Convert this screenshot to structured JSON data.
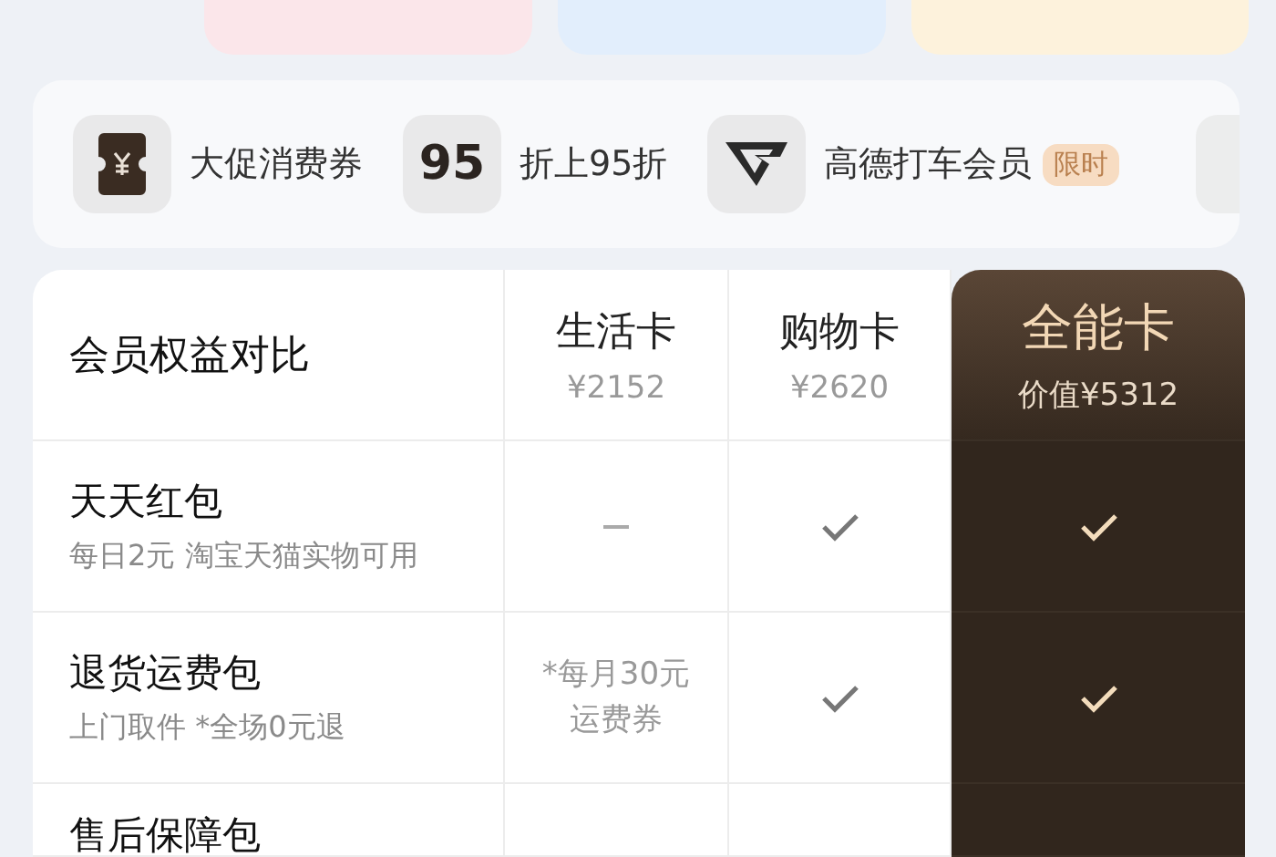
{
  "top_cards": [
    {
      "color": "#fbe6ea"
    },
    {
      "color": "#e2eefc"
    },
    {
      "color": "#fdf2dc"
    }
  ],
  "perks": [
    {
      "kind": "ticket",
      "label": "大促消费券"
    },
    {
      "kind": "number",
      "icon_text": "95",
      "label": "折上95折"
    },
    {
      "kind": "logo",
      "label": "高德打车会员",
      "badge": "限时"
    }
  ],
  "table": {
    "title": "会员权益对比",
    "plans": [
      {
        "name": "生活卡",
        "price": "¥2152",
        "featured": false
      },
      {
        "name": "购物卡",
        "price": "¥2620",
        "featured": false
      },
      {
        "name": "全能卡",
        "price": "价值¥5312",
        "featured": true
      }
    ],
    "rows": [
      {
        "name": "天天红包",
        "desc": "每日2元 淘宝天猫实物可用",
        "cells": [
          {
            "kind": "dash"
          },
          {
            "kind": "check"
          },
          {
            "kind": "check"
          }
        ]
      },
      {
        "name": "退货运费包",
        "desc": "上门取件 *全场0元退",
        "cells": [
          {
            "kind": "text",
            "lines": [
              "*每月30元",
              "运费券"
            ]
          },
          {
            "kind": "check"
          },
          {
            "kind": "check"
          }
        ]
      },
      {
        "name": "售后保障包",
        "cells": [
          {
            "kind": "empty"
          },
          {
            "kind": "empty"
          },
          {
            "kind": "empty"
          }
        ]
      }
    ]
  }
}
